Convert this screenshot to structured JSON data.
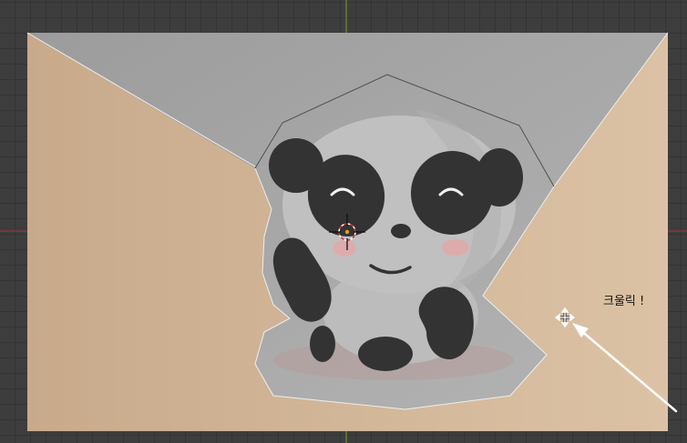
{
  "annotation": {
    "text": "크울릭 !"
  },
  "colors": {
    "viewport_bg": "#3d3d3d",
    "grid_line": "#343434",
    "x_axis": "#8a3a42",
    "y_axis": "#6e8e2a",
    "plane_left": "#c9ab8c",
    "plane_right": "#dcc1a3",
    "cutout_gray": "#a8a8a8",
    "panda_body": "#bdbdbd",
    "panda_black": "#333333",
    "blush": "#e3a8a8",
    "outline": "#e8e8e8",
    "arrow": "#ffffff"
  },
  "icons": {
    "cursor_3d": "3d-cursor-icon",
    "move_cursor": "move-cursor-icon",
    "arrow": "pointer-arrow-icon"
  }
}
